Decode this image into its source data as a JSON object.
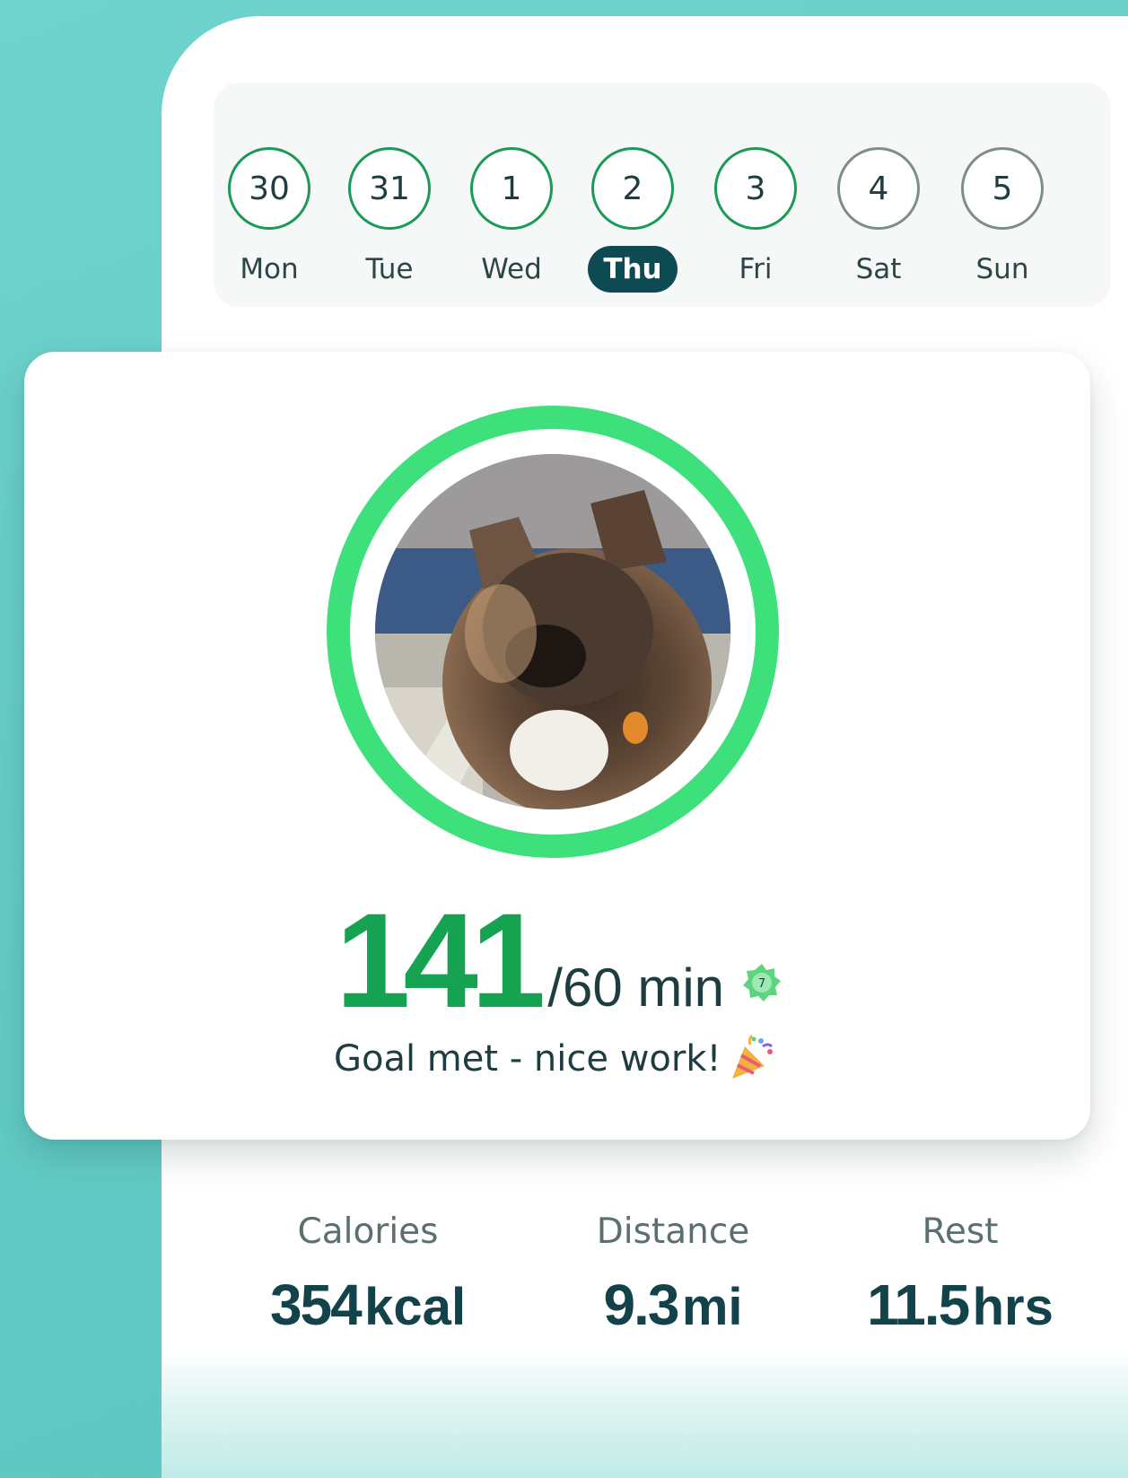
{
  "week": {
    "days": [
      {
        "date": "30",
        "name": "Mon",
        "state": "done"
      },
      {
        "date": "31",
        "name": "Tue",
        "state": "done"
      },
      {
        "date": "1",
        "name": "Wed",
        "state": "done"
      },
      {
        "date": "2",
        "name": "Thu",
        "state": "selected"
      },
      {
        "date": "3",
        "name": "Fri",
        "state": "done"
      },
      {
        "date": "4",
        "name": "Sat",
        "state": "future"
      },
      {
        "date": "5",
        "name": "Sun",
        "state": "future"
      }
    ]
  },
  "activity": {
    "minutes": "141",
    "goal": "/60 min",
    "streak_badge": "7",
    "message": "Goal met - nice work!",
    "progress_fraction": 1.0,
    "photo_icon": "dog-photo",
    "celebration_icon": "party-popper-icon"
  },
  "stats": [
    {
      "label": "Calories",
      "number": "354",
      "unit": "kcal"
    },
    {
      "label": "Distance",
      "number": "9.3",
      "unit": "mi"
    },
    {
      "label": "Rest",
      "number": "11.5",
      "unit": "hrs"
    }
  ],
  "colors": {
    "background": "#63cbc5",
    "ring": "#3ee07c",
    "accent_green": "#15a352",
    "selected_day": "#0d4a52"
  }
}
